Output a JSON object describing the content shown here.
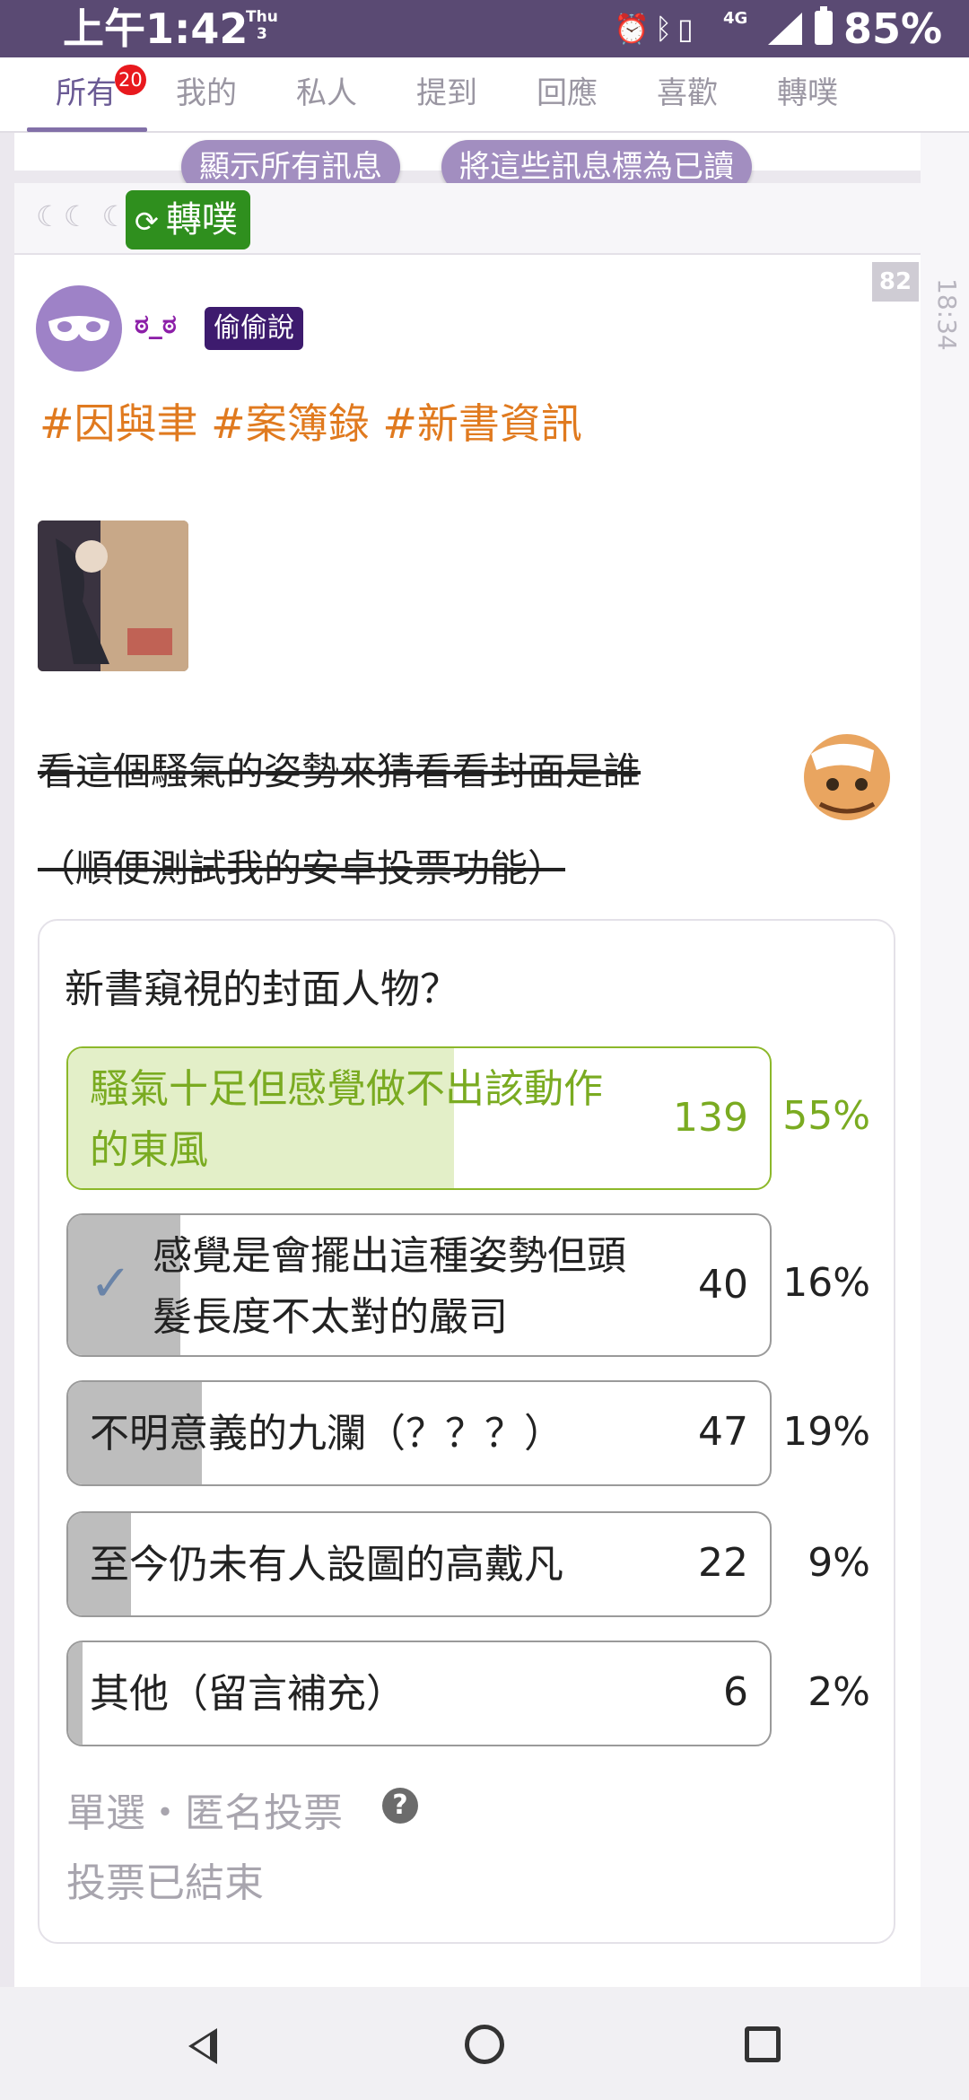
{
  "status_bar": {
    "time": "上午1:42",
    "day_line1": "Thu",
    "day_line2": "3",
    "network": "4G",
    "battery": "85%"
  },
  "tabs": [
    {
      "label": "所有"
    },
    {
      "label": "我的"
    },
    {
      "label": "私人"
    },
    {
      "label": "提到"
    },
    {
      "label": "回應"
    },
    {
      "label": "喜歡"
    },
    {
      "label": "轉噗"
    }
  ],
  "tab_badge": "20",
  "message_buttons": {
    "show_all": "顯示所有訊息",
    "mark_read": "將這些訊息標為已讀"
  },
  "plurk": {
    "moons": "☾☾ ☾☾",
    "replurk_label": "轉噗",
    "response_count": "82",
    "timestamp": "18:34",
    "username": "ಠ_ಠ",
    "qualifier": "偷偷說",
    "hashtags": "#因與聿 #案簿錄 #新書資訊",
    "struck_line1": "看這個騷氣的姿勢來猜看看封面是誰",
    "struck_line2": "（順便測試我的安卓投票功能）"
  },
  "poll": {
    "question": "新書窺視的封面人物？",
    "options": [
      {
        "line1": "騷氣十足但感覺做不出該動作",
        "line2": "的東風",
        "count": "139",
        "percent": "55%",
        "fraction": 0.55,
        "winner": true,
        "voted": false
      },
      {
        "line1": "感覺是會擺出這種姿勢但頭",
        "line2": "髮長度不太對的嚴司",
        "count": "40",
        "percent": "16%",
        "fraction": 0.16,
        "winner": false,
        "voted": true
      },
      {
        "line1": "不明意義的九瀾（？？？）",
        "line2": "",
        "count": "47",
        "percent": "19%",
        "fraction": 0.19,
        "winner": false,
        "voted": false
      },
      {
        "line1": "至今仍未有人設圖的高戴凡",
        "line2": "",
        "count": "22",
        "percent": "9%",
        "fraction": 0.09,
        "winner": false,
        "voted": false
      },
      {
        "line1": "其他（留言補充）",
        "line2": "",
        "count": "6",
        "percent": "2%",
        "fraction": 0.02,
        "winner": false,
        "voted": false
      }
    ],
    "meta_type": "單選・匿名投票",
    "meta_help": "?",
    "meta_status": "投票已結束"
  },
  "colors": {
    "status_bar": "#5a4a73",
    "accent": "#8270a8",
    "hashtag": "#e07a1f",
    "winner": "#7aab21",
    "replurk": "#2f8f1e",
    "qualifier": "#3d1b6e"
  }
}
